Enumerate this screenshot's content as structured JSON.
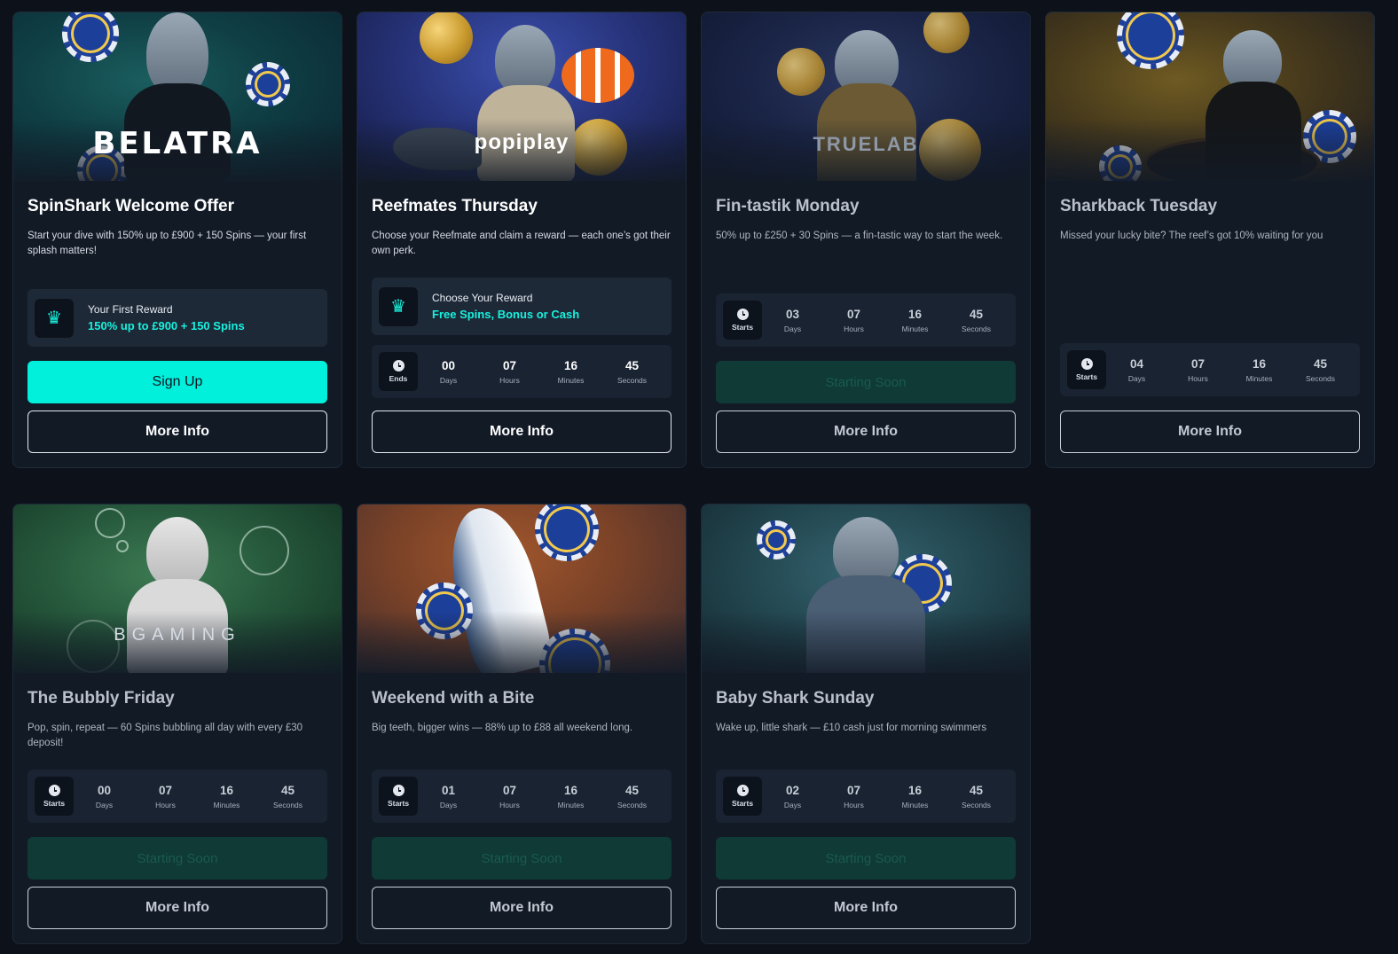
{
  "cards": [
    {
      "brand": "BELATRA",
      "title": "SpinShark Welcome Offer",
      "desc": "Start your dive with 150% up to £900 + 150 Spins — your first splash matters!",
      "reward": {
        "label": "Your First Reward",
        "value": "150% up to £900 + 150 Spins",
        "icon": "crown-icon"
      },
      "primary": "Sign Up",
      "more": "More Info",
      "colors": {
        "bg_top": "#0f4548",
        "bg_bottom": "#0e2a35"
      }
    },
    {
      "brand": "popiplay",
      "title": "Reefmates Thursday",
      "desc": "Choose your Reefmate and claim a reward — each one’s got their own perk.",
      "reward": {
        "label": "Choose Your Reward",
        "value": "Free Spins, Bonus or Cash",
        "icon": "crown-icon"
      },
      "timer": {
        "status": "Ends",
        "days": "00",
        "hours": "07",
        "minutes": "16",
        "seconds": "45"
      },
      "more": "More Info",
      "colors": {
        "bg_top": "#2c3c8f",
        "bg_bottom": "#1b2453"
      }
    },
    {
      "brand": "TRUELAB",
      "title": "Fin-tastik Monday",
      "desc": "50% up to £250 + 30 Spins — a fin-tastic way to start the week.",
      "timer": {
        "status": "Starts",
        "days": "03",
        "hours": "07",
        "minutes": "16",
        "seconds": "45"
      },
      "primary": "Starting Soon",
      "more": "More Info",
      "colors": {
        "bg_top": "#1d2a52",
        "bg_bottom": "#162038"
      }
    },
    {
      "title": "Sharkback Tuesday",
      "desc": "Missed your lucky bite? The reef’s got 10% waiting for you",
      "timer": {
        "status": "Starts",
        "days": "04",
        "hours": "07",
        "minutes": "16",
        "seconds": "45"
      },
      "more": "More Info",
      "colors": {
        "bg_top": "#5a4a1e",
        "bg_bottom": "#241f1a"
      }
    },
    {
      "brand": "BGAMING",
      "title": "The Bubbly Friday",
      "desc": "Pop, spin, repeat — 60 Spins bubbling all day with every £30 deposit!",
      "timer": {
        "status": "Starts",
        "days": "00",
        "hours": "07",
        "minutes": "16",
        "seconds": "45"
      },
      "primary": "Starting Soon",
      "more": "More Info",
      "colors": {
        "bg_top": "#2f6b45",
        "bg_bottom": "#173525"
      }
    },
    {
      "title": "Weekend with a Bite",
      "desc": "Big teeth, bigger wins — 88% up to £88 all weekend long.",
      "timer": {
        "status": "Starts",
        "days": "01",
        "hours": "07",
        "minutes": "16",
        "seconds": "45"
      },
      "primary": "Starting Soon",
      "more": "More Info",
      "colors": {
        "bg_top": "#8a4a2a",
        "bg_bottom": "#3a2a2a"
      }
    },
    {
      "title": "Baby Shark Sunday",
      "desc": "Wake up, little shark — £10 cash just for morning swimmers",
      "timer": {
        "status": "Starts",
        "days": "02",
        "hours": "07",
        "minutes": "16",
        "seconds": "45"
      },
      "primary": "Starting Soon",
      "more": "More Info",
      "colors": {
        "bg_top": "#2b5560",
        "bg_bottom": "#1a3038"
      }
    }
  ],
  "labels": {
    "days": "Days",
    "hours": "Hours",
    "minutes": "Minutes",
    "seconds": "Seconds"
  },
  "accent": "#00f0dc"
}
